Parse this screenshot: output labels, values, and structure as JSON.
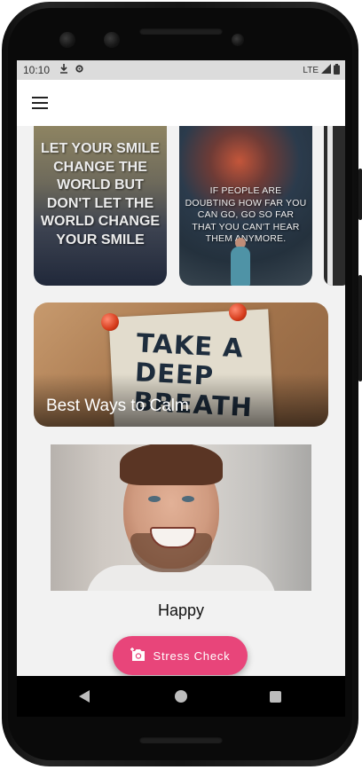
{
  "status_bar": {
    "time": "10:10",
    "network": "LTE",
    "icons": [
      "download-icon",
      "settings-icon",
      "signal-icon",
      "battery-icon"
    ]
  },
  "app_bar": {
    "menu_icon": "hamburger-menu-icon"
  },
  "quotes": [
    {
      "text": "LET YOUR SMILE CHANGE THE WORLD BUT DON'T LET THE WORLD CHANGE YOUR SMILE"
    },
    {
      "text": "IF PEOPLE ARE DOUBTING HOW FAR YOU CAN GO, GO SO FAR THAT YOU CAN'T HEAR THEM ANYMORE."
    }
  ],
  "calm_card": {
    "title": "Best Ways to Calm",
    "note_text": "TAKE A DEEP BREATH"
  },
  "mood": {
    "label": "Happy"
  },
  "fab": {
    "label": "Stress Check",
    "icon": "add-photo-camera-icon",
    "color": "#e8457a"
  },
  "nav_bar": {
    "icons": [
      "back-icon",
      "home-icon",
      "recents-icon"
    ]
  }
}
